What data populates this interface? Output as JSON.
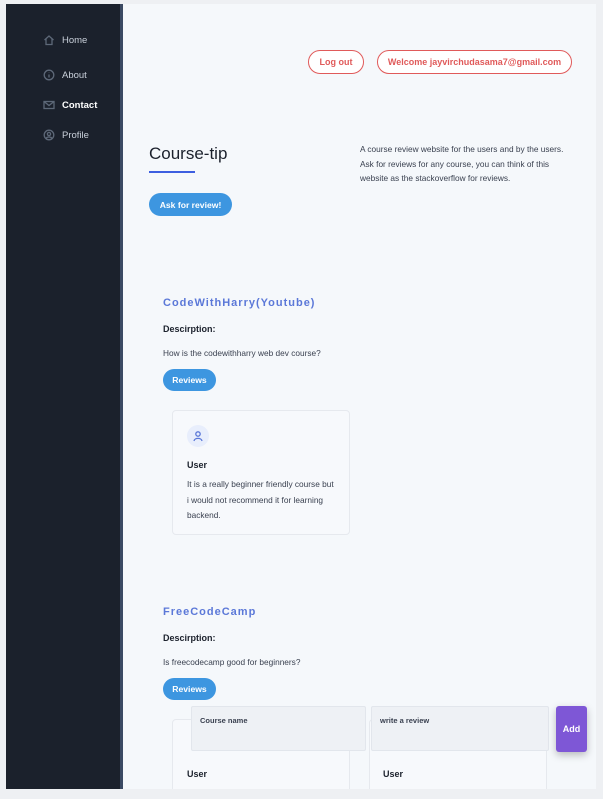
{
  "sidebar": {
    "items": [
      {
        "label": "Home",
        "icon": "home-icon"
      },
      {
        "label": "About",
        "icon": "info-icon"
      },
      {
        "label": "Contact",
        "icon": "mail-icon",
        "active": true
      },
      {
        "label": "Profile",
        "icon": "user-circle-icon"
      }
    ]
  },
  "header": {
    "logout_label": "Log out",
    "welcome_label": "Welcome jayvirchudasama7@gmail.com"
  },
  "hero": {
    "title": "Course-tip",
    "description": "A course review website for the users and by the users. Ask for reviews for any course, you can think of this website as the stackoverflow for reviews.",
    "ask_button": "Ask for review!"
  },
  "courses": [
    {
      "name": "CodeWithHarry(Youtube)",
      "description_label": "Descirption:",
      "question": "How is the codewithharry web dev course?",
      "reviews_button": "Reviews",
      "reviews": [
        {
          "user": "User",
          "text": "It is a really beginner friendly course but i would not recommend it for learning backend."
        }
      ]
    },
    {
      "name": "FreeCodeCamp",
      "description_label": "Descirption:",
      "question": "Is freecodecamp good for beginners?",
      "reviews_button": "Reviews",
      "reviews": [
        {
          "user": "User"
        },
        {
          "user": "User"
        }
      ]
    }
  ],
  "review_form": {
    "course_name_label": "Course name",
    "review_label": "write a review",
    "add_button": "Add"
  },
  "colors": {
    "sidebar_bg": "#1b212c",
    "accent_blue": "#3d96e0",
    "course_title": "#5b78d8",
    "logout_red": "#e05a5a",
    "add_purple": "#7e57d6"
  }
}
